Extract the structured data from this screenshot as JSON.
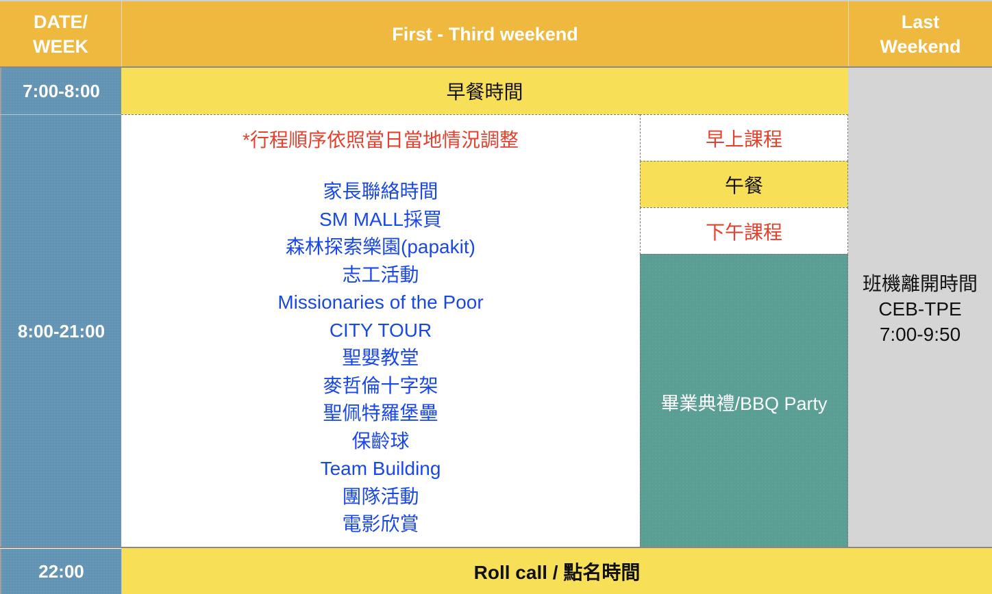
{
  "header": {
    "date_week": "DATE/\nWEEK",
    "date_week_line1": "DATE/",
    "date_week_line2": "WEEK",
    "first_third": "First - Third weekend",
    "last_weekend_line1": "Last",
    "last_weekend_line2": "Weekend"
  },
  "rows": {
    "breakfast": {
      "time": "7:00-8:00",
      "label": "早餐時間"
    },
    "day": {
      "time": "8:00-21:00",
      "note": "*行程順序依照當日當地情況調整",
      "activities": [
        "家長聯絡時間",
        "SM MALL採買",
        "森林探索樂園(papakit)",
        "志工活動",
        "Missionaries of the Poor",
        "CITY TOUR",
        "聖嬰教堂",
        "麥哲倫十字架",
        "聖佩特羅堡壘",
        "保齡球",
        "Team Building",
        "團隊活動",
        "電影欣賞"
      ],
      "last_weekend_schedule": {
        "morning": "早上課程",
        "lunch": "午餐",
        "afternoon": "下午課程",
        "graduation": "畢業典禮/BBQ Party"
      },
      "departure": {
        "line1": "班機離開時間",
        "line2": "CEB-TPE",
        "line3": "7:00-9:50"
      }
    },
    "rollcall": {
      "time": "22:00",
      "label": "Roll call / 點名時間"
    }
  },
  "colors": {
    "header": "#efb83f",
    "time_column": "#6494b4",
    "yellow": "#f7df58",
    "grey": "#d5d5d5",
    "teal": "#5a9e94",
    "red_text": "#e6402e",
    "blue_text": "#1a48e6"
  }
}
